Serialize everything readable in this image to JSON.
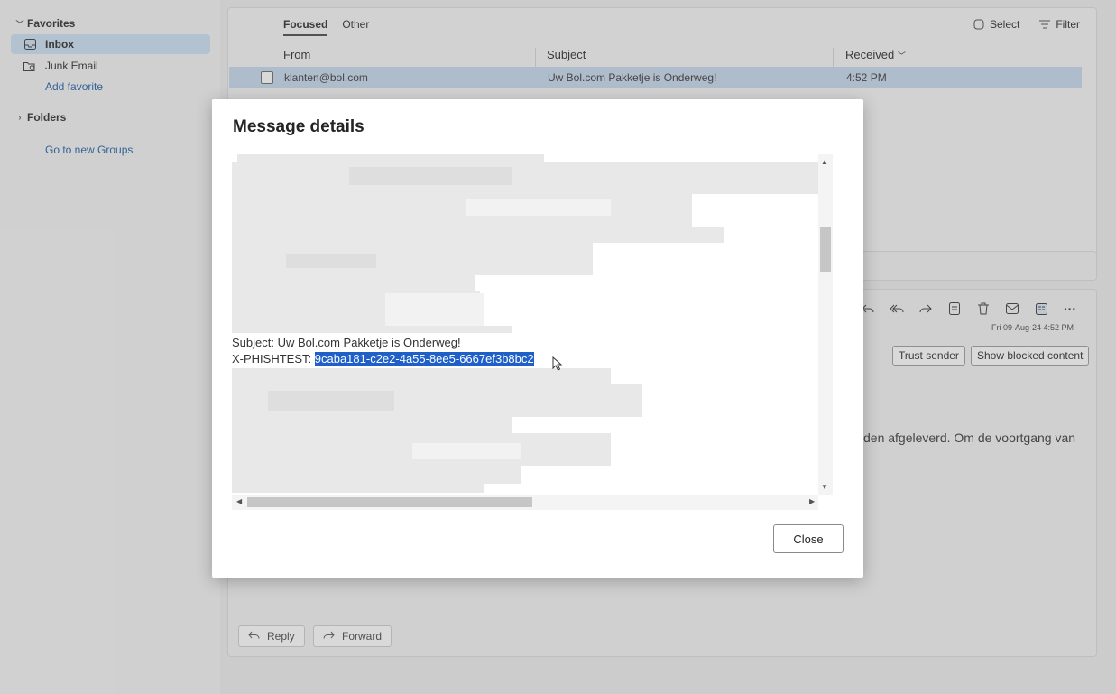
{
  "nav": {
    "favorites": "Favorites",
    "inbox": "Inbox",
    "junk": "Junk Email",
    "add_favorite": "Add favorite",
    "folders": "Folders",
    "groups": "Go to new Groups"
  },
  "list": {
    "tabs": [
      "Focused",
      "Other"
    ],
    "select": "Select",
    "filter": "Filter",
    "columns": {
      "from": "From",
      "subject": "Subject",
      "received": "Received"
    },
    "rows": [
      {
        "from": "klanten@bol.com",
        "subject": "Uw Bol.com Pakketje is Onderweg!",
        "received": "4:52 PM"
      }
    ]
  },
  "reading": {
    "date": "Fri 09-Aug-24 4:52 PM",
    "trust_sender": "Trust sender",
    "show_blocked": "Show blocked content",
    "body_fragment": "den afgeleverd. Om de voortgang van",
    "reply": "Reply",
    "forward": "Forward"
  },
  "dialog": {
    "title": "Message details",
    "subject_line": "Subject: Uw Bol.com Pakketje is Onderweg!",
    "phish_label": "X-PHISHTEST: ",
    "phish_value": "9caba181-c2e2-4a55-8ee5-6667ef3b8bc2",
    "close": "Close"
  },
  "colors": {
    "accent": "#1f5fc8",
    "selected_row": "#c4d7ec",
    "nav_selected": "#c9dff4"
  }
}
